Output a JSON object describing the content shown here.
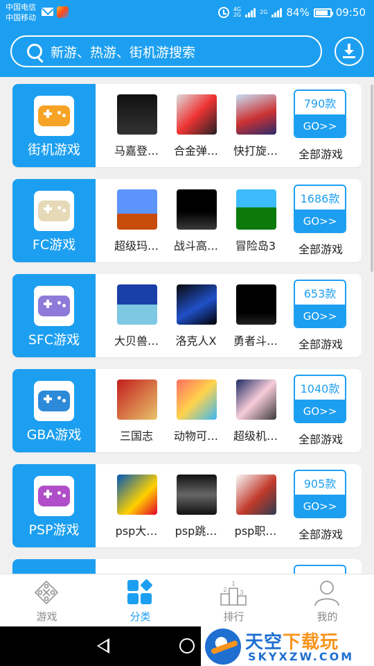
{
  "status_bar": {
    "carrier_1": "中国电信",
    "carrier_2": "中国移动",
    "network_1": "4G",
    "network_2": "2G",
    "network_3": "2G",
    "battery": "84%",
    "battery_level": 0.84,
    "time": "09:50"
  },
  "header": {
    "search_placeholder": "新游、热游、街机游搜索"
  },
  "categories": [
    {
      "label": "街机游戏",
      "icon": "arcade-joystick-icon",
      "games": [
        {
          "name": "马嘉登…",
          "cover": "cover-arcade-1"
        },
        {
          "name": "合金弹…",
          "cover": "cover-metal-slug-3"
        },
        {
          "name": "快打旋…",
          "cover": "cover-final-fight"
        }
      ],
      "count": "790款",
      "go": "GO>>",
      "all": "全部游戏"
    },
    {
      "label": "FC游戏",
      "icon": "fc-controller-icon",
      "games": [
        {
          "name": "超级玛…",
          "cover": "cover-mario"
        },
        {
          "name": "战斗高…",
          "cover": "cover-fighting-golf"
        },
        {
          "name": "冒险岛3",
          "cover": "cover-adventure-island"
        }
      ],
      "count": "1686款",
      "go": "GO>>",
      "all": "全部游戏"
    },
    {
      "label": "SFC游戏",
      "icon": "sfc-controller-icon",
      "games": [
        {
          "name": "大贝兽…",
          "cover": "cover-daikaijuu"
        },
        {
          "name": "洛克人X",
          "cover": "cover-megaman-x"
        },
        {
          "name": "勇者斗…",
          "cover": "cover-dragon-quest"
        }
      ],
      "count": "653款",
      "go": "GO>>",
      "all": "全部游戏"
    },
    {
      "label": "GBA游戏",
      "icon": "gba-handheld-icon",
      "games": [
        {
          "name": "三国志",
          "cover": "cover-sangokushi"
        },
        {
          "name": "动物可…",
          "cover": "cover-animal"
        },
        {
          "name": "超级机…",
          "cover": "cover-super-robot"
        }
      ],
      "count": "1040款",
      "go": "GO>>",
      "all": "全部游戏"
    },
    {
      "label": "PSP游戏",
      "icon": "psp-handheld-icon",
      "games": [
        {
          "name": "psp大…",
          "cover": "cover-psp-1"
        },
        {
          "name": "psp跳…",
          "cover": "cover-exceed"
        },
        {
          "name": "psp职…",
          "cover": "cover-baseball"
        }
      ],
      "count": "905款",
      "go": "GO>>",
      "all": "全部游戏"
    }
  ],
  "bottom_nav": [
    {
      "label": "游戏",
      "icon": "gamepad-icon",
      "active": false
    },
    {
      "label": "分类",
      "icon": "category-grid-icon",
      "active": true
    },
    {
      "label": "排行",
      "icon": "ranking-podium-icon",
      "active": false
    },
    {
      "label": "我的",
      "icon": "user-profile-icon",
      "active": false
    }
  ],
  "ranking_podium_numbers": [
    "2",
    "1",
    "3"
  ],
  "watermark": {
    "title_main": "天空",
    "title_accent": "下载玩",
    "url": "SKYXZW.COM"
  },
  "colors": {
    "accent": "#1c9ff0",
    "background": "#f0f0f0",
    "watermark_blue": "#1f6fd1",
    "watermark_orange": "#f7941d"
  }
}
